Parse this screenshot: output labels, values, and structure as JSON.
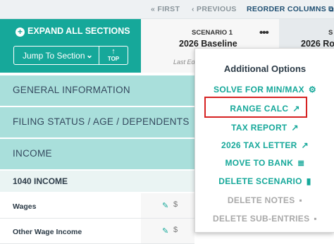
{
  "topnav": {
    "first_label": "« FIRST",
    "previous_label": "‹ PREVIOUS",
    "reorder_label": "REORDER COLUMNS"
  },
  "sidebar": {
    "expand_all_label": "EXPAND ALL SECTIONS",
    "jump_to_section_label": "Jump To Section",
    "top_label": "TOP"
  },
  "scenarios": [
    {
      "title": "SCENARIO 1",
      "name": "2026 Baseline",
      "subtitle": "Last Edi"
    },
    {
      "title": "S",
      "name": "2026 Ro"
    }
  ],
  "sections": [
    {
      "label": "GENERAL INFORMATION"
    },
    {
      "label": "FILING STATUS / AGE / DEPENDENTS"
    },
    {
      "label": "INCOME"
    }
  ],
  "subsection": {
    "label": "1040 INCOME"
  },
  "rows": [
    {
      "label": "Wages",
      "currency": "$"
    },
    {
      "label": "Other Wage Income",
      "currency": "$"
    }
  ],
  "menu": {
    "title": "Additional Options",
    "items": [
      {
        "label": "SOLVE FOR MIN/MAX",
        "icon": "gears-icon",
        "enabled": true
      },
      {
        "label": "RANGE CALC",
        "icon": "external-link-icon",
        "enabled": true,
        "highlighted": true
      },
      {
        "label": "TAX REPORT",
        "icon": "external-link-icon",
        "enabled": true
      },
      {
        "label": "2026 TAX LETTER",
        "icon": "external-link-icon",
        "enabled": true
      },
      {
        "label": "MOVE TO BANK",
        "icon": "list-icon",
        "enabled": true
      },
      {
        "label": "DELETE SCENARIO",
        "icon": "trash-icon",
        "enabled": true
      },
      {
        "label": "DELETE NOTES",
        "icon": "note-icon",
        "enabled": false
      },
      {
        "label": "DELETE SUB-ENTRIES",
        "icon": "note-icon",
        "enabled": false
      }
    ]
  },
  "colors": {
    "teal": "#16a89a",
    "section_bg": "#a9dfdb",
    "highlight_border": "#d62222",
    "disabled": "#a9a9a9"
  }
}
